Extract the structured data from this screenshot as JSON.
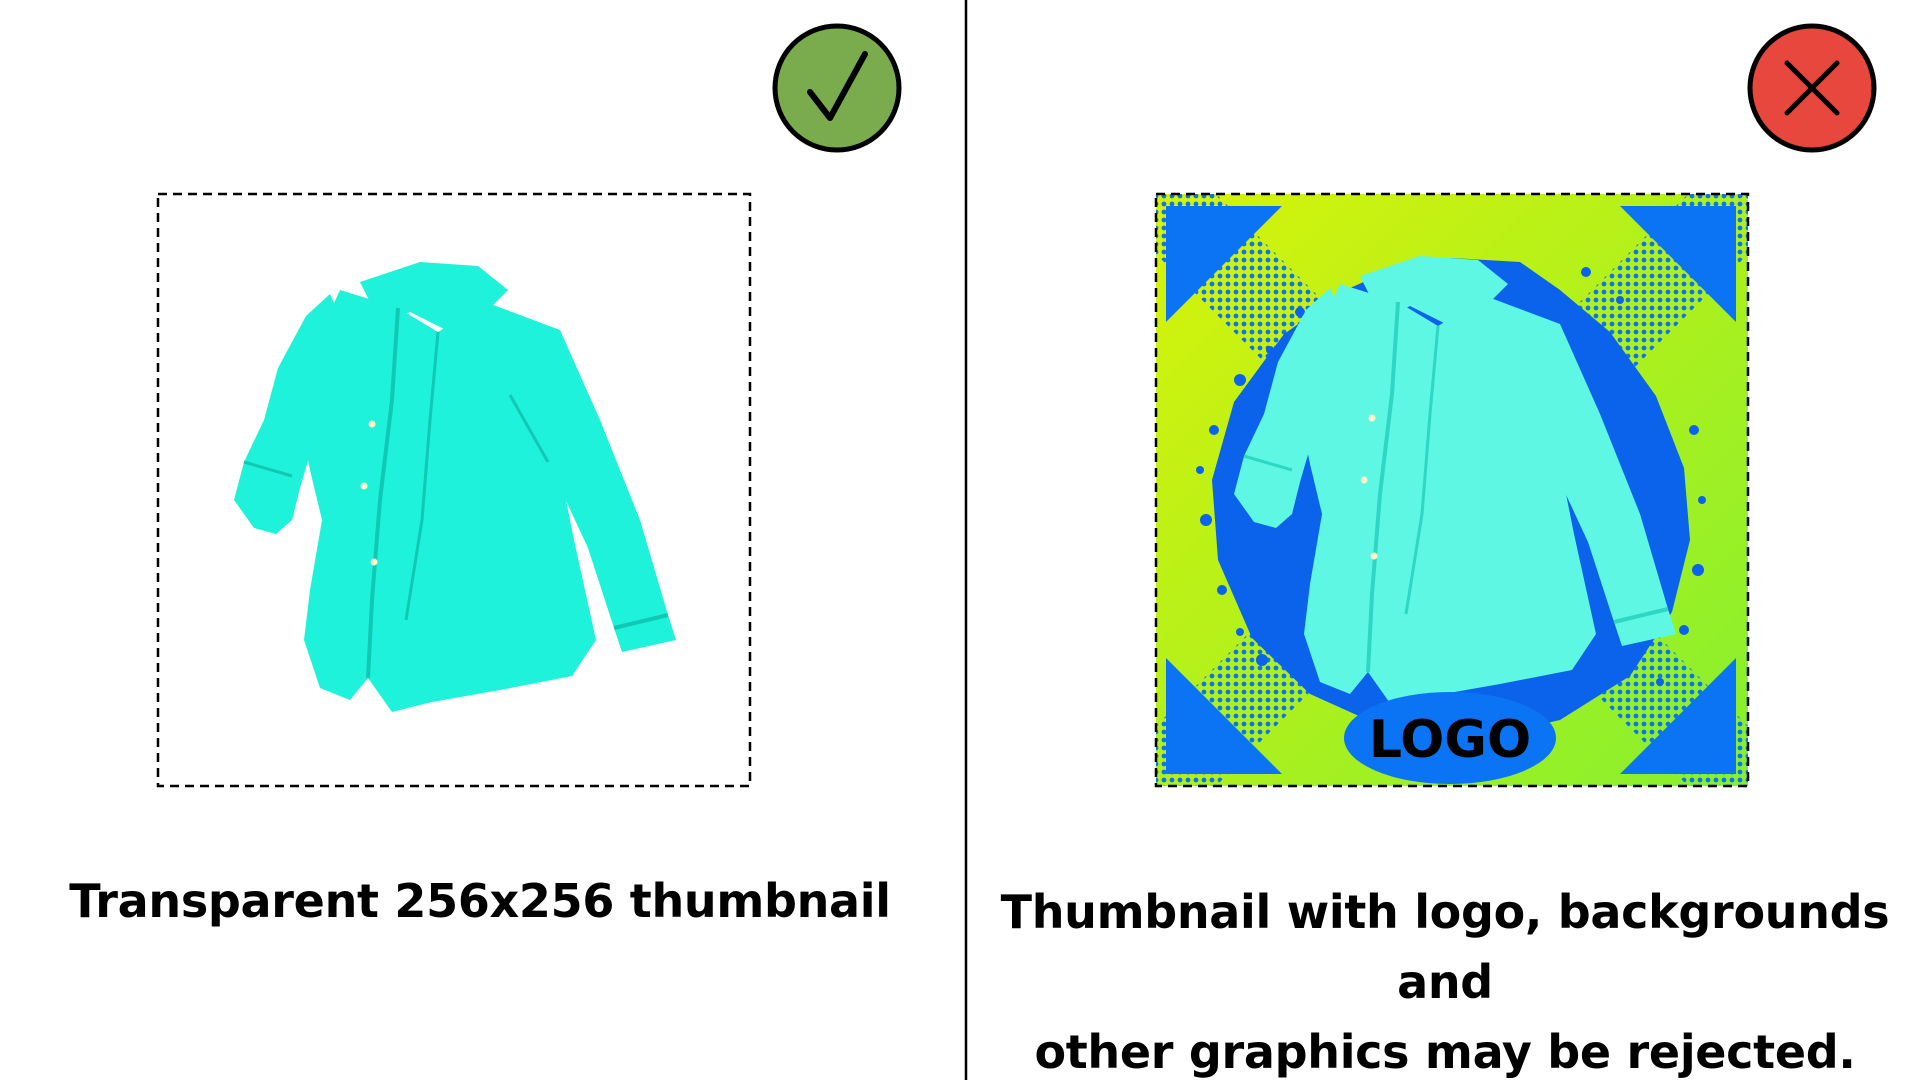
{
  "colors": {
    "background": "#ffffff",
    "divider": "#000000",
    "accept_badge": "#7aab4d",
    "reject_badge": "#e8473e",
    "shirt": "#1ff2da",
    "shirt_shade": "#10c9b4",
    "bg_gradient_start": "#d8f20a",
    "bg_gradient_end": "#86ef2f",
    "bg_blue": "#0a74f5",
    "bg_splash": "#0b63ec"
  },
  "icons": {
    "accept": "checkmark-icon",
    "reject": "x-mark-icon"
  },
  "good_example": {
    "caption": "Transparent 256x256 thumbnail"
  },
  "bad_example": {
    "logo_text": "LOGO",
    "caption_lines": [
      "Thumbnail with logo, backgrounds and",
      "other graphics may be rejected."
    ]
  }
}
